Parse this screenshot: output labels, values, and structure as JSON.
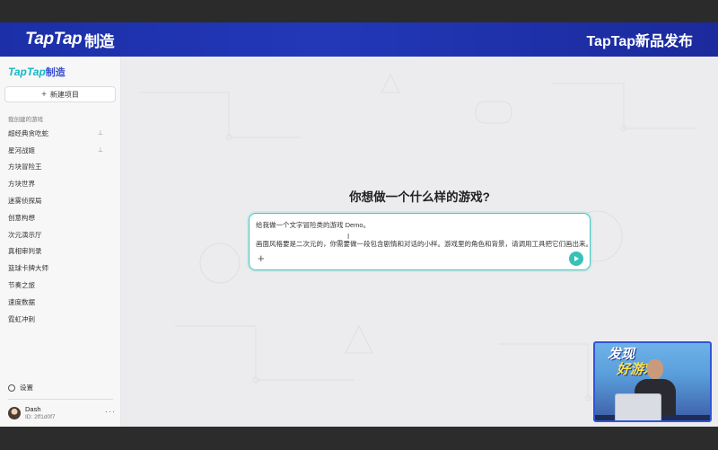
{
  "banner": {
    "brand": "TapTap",
    "brand_suffix": "制造",
    "title": "TapTap新品发布"
  },
  "sidebar": {
    "logo": "TapTap",
    "logo_suffix": "制造",
    "new_project": "新建项目",
    "section_label": "我创建的游戏",
    "games": [
      {
        "name": "超经典贪吃蛇",
        "pinned": true
      },
      {
        "name": "星河战姬",
        "pinned": true
      },
      {
        "name": "方块冒险王",
        "pinned": false
      },
      {
        "name": "方块世界",
        "pinned": false
      },
      {
        "name": "迷雾侦探局",
        "pinned": false
      },
      {
        "name": "创意构想",
        "pinned": false
      },
      {
        "name": "次元演示厅",
        "pinned": false
      },
      {
        "name": "真相审判录",
        "pinned": false
      },
      {
        "name": "篮球卡牌大师",
        "pinned": false
      },
      {
        "name": "节奏之旅",
        "pinned": false
      },
      {
        "name": "速度数据",
        "pinned": false
      },
      {
        "name": "霓虹冲刺",
        "pinned": false
      }
    ],
    "settings": "设置",
    "user": {
      "name": "Dash",
      "id": "ID: 2ff1d0f7"
    }
  },
  "main": {
    "headline": "你想做一个什么样的游戏?",
    "prompt": {
      "line1": "给我做一个文字冒险类的游戏 Demo。",
      "line2": "画面风格要是二次元的，你需要做一段包含剧情和对话的小样。游戏里的角色和背景，请调用工具把它们画出来。"
    }
  },
  "overlay": {
    "line1": "发现",
    "line2": "好游戏"
  },
  "colors": {
    "banner": "#1c2fa8",
    "accent": "#37c2b8",
    "logo": "#14b8c4"
  }
}
